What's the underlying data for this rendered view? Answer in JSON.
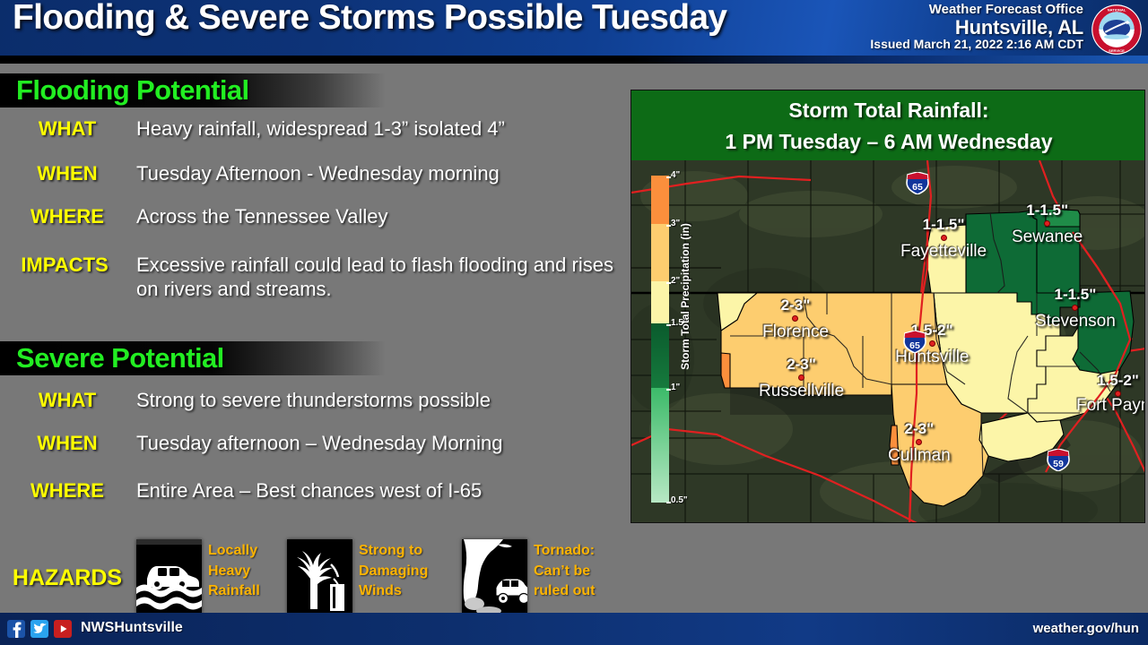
{
  "header": {
    "title": "Flooding & Severe Storms Possible Tuesday",
    "office_line": "Weather Forecast Office",
    "office_name": "Huntsville, AL",
    "issued": "Issued March 21, 2022 2:16 AM CDT",
    "logo_name": "nws-seal",
    "bg_color": "#0f3f92"
  },
  "flooding": {
    "heading": "Flooding Potential",
    "heading_color": "#22ee22",
    "rows": [
      {
        "label": "WHAT",
        "value": "Heavy rainfall, widespread 1-3” isolated 4”"
      },
      {
        "label": "WHEN",
        "value": "Tuesday Afternoon - Wednesday morning"
      },
      {
        "label": "WHERE",
        "value": "Across the Tennessee Valley"
      },
      {
        "label": "IMPACTS",
        "value": "Excessive rainfall could lead to flash flooding and rises on rivers and streams."
      }
    ]
  },
  "severe": {
    "heading": "Severe Potential",
    "heading_color": "#22ee22",
    "rows": [
      {
        "label": "WHAT",
        "value": "Strong to severe thunderstorms possible"
      },
      {
        "label": "WHEN",
        "value": "Tuesday afternoon – Wednesday Morning"
      },
      {
        "label": "WHERE",
        "value": "Entire Area – Best chances west of I-65"
      }
    ],
    "hazards_label": "HAZARDS",
    "hazards": [
      {
        "icon": "flooded-car-icon",
        "text": "Locally Heavy Rainfall"
      },
      {
        "icon": "wind-blown-tree-icon",
        "text": "Strong to Damaging Winds"
      },
      {
        "icon": "tornado-icon",
        "text": "Tornado: Can’t be ruled out"
      }
    ],
    "hazard_text_color": "#ffb400"
  },
  "map": {
    "title_line1": "Storm Total Rainfall:",
    "title_line2": "1 PM Tuesday – 6 AM Wednesday",
    "title_bg": "#0d6b16",
    "colorbar": {
      "axis_label": "Storm Total Precipitation (in)",
      "ticks": [
        "4\"",
        "3\"",
        "2\"",
        "1.5\"",
        "1\"",
        "0.5\""
      ],
      "colors": [
        "#fb8f3c",
        "#fdcd6f",
        "#fcf5a8",
        "#0e6b36",
        "#4cc878"
      ]
    },
    "cities": [
      {
        "name": "Fayetteville",
        "amount": "1-1.5\""
      },
      {
        "name": "Sewanee",
        "amount": "1-1.5\""
      },
      {
        "name": "Stevenson",
        "amount": "1-1.5\""
      },
      {
        "name": "Huntsville",
        "amount": "1.5-2\""
      },
      {
        "name": "Fort Payne",
        "amount": "1.5-2\""
      },
      {
        "name": "Florence",
        "amount": "2-3\""
      },
      {
        "name": "Russellville",
        "amount": "2-3\""
      },
      {
        "name": "Cullman",
        "amount": "2-3\""
      }
    ],
    "interstates": [
      "65",
      "65",
      "59"
    ]
  },
  "footer": {
    "handle": "NWSHuntsville",
    "url": "weather.gov/hun",
    "icons": [
      "facebook-icon",
      "twitter-icon",
      "youtube-icon"
    ]
  },
  "chart_data": {
    "type": "heatmap",
    "title": "Storm Total Rainfall: 1 PM Tuesday – 6 AM Wednesday",
    "ylabel": "Storm Total Precipitation (in)",
    "legend_position": "left",
    "grid": false,
    "bins": [
      0.5,
      1,
      1.5,
      2,
      3,
      4
    ],
    "bin_colors": [
      "#4cc878",
      "#0e6b36",
      "#fcf5a8",
      "#fdcd6f",
      "#fb8f3c"
    ],
    "categories": [
      "Fayetteville",
      "Sewanee",
      "Stevenson",
      "Huntsville",
      "Fort Payne",
      "Florence",
      "Russellville",
      "Cullman"
    ],
    "values": [
      1.25,
      1.25,
      1.25,
      1.75,
      1.75,
      2.5,
      2.5,
      2.5
    ],
    "value_labels": [
      "1-1.5\"",
      "1-1.5\"",
      "1-1.5\"",
      "1.5-2\"",
      "1.5-2\"",
      "2-3\"",
      "2-3\"",
      "2-3\""
    ]
  }
}
